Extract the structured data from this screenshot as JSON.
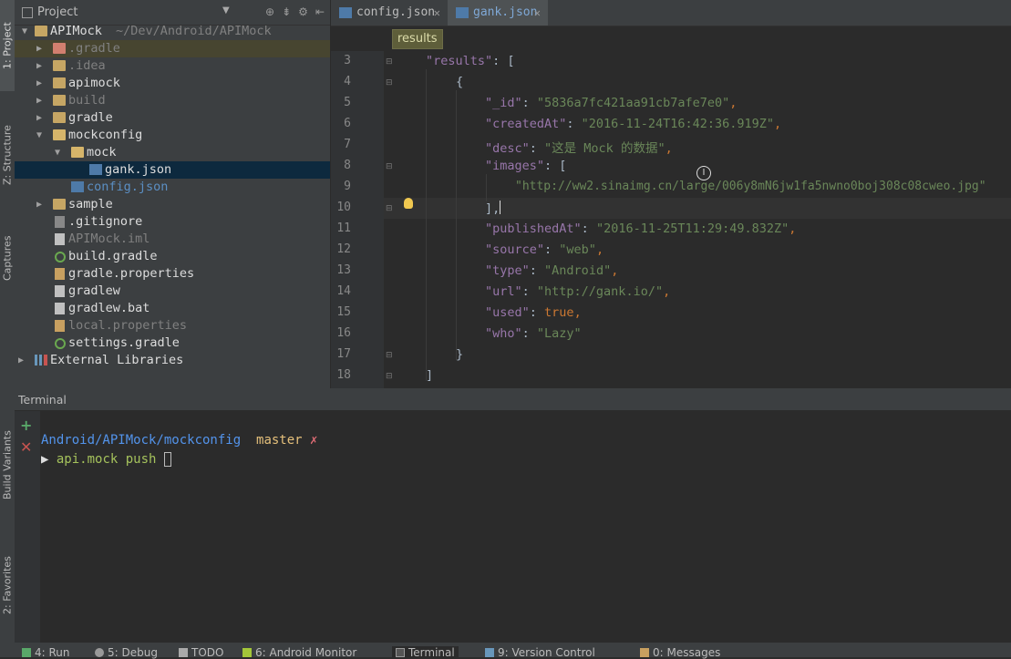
{
  "left_strip": {
    "tabs": [
      {
        "label": "1: Project",
        "active": true
      },
      {
        "label": "Z: Structure",
        "active": false
      },
      {
        "label": "Captures",
        "active": false
      },
      {
        "label": "Build Variants",
        "active": false
      },
      {
        "label": "2: Favorites",
        "active": false
      }
    ]
  },
  "project": {
    "header": "Project",
    "tree": [
      {
        "label": "APIMock",
        "suffix": "~/Dev/Android/APIMock",
        "icon": "folder-icon"
      },
      {
        "label": ".gradle",
        "icon": "folder-icon"
      },
      {
        "label": ".idea",
        "icon": "folder-icon"
      },
      {
        "label": "apimock",
        "icon": "module-folder-icon"
      },
      {
        "label": "build",
        "icon": "folder-icon"
      },
      {
        "label": "gradle",
        "icon": "folder-icon"
      },
      {
        "label": "mockconfig",
        "icon": "module-folder-icon"
      },
      {
        "label": "mock",
        "icon": "folder-icon"
      },
      {
        "label": "gank.json",
        "icon": "json-file-icon"
      },
      {
        "label": "config.json",
        "icon": "json-file-icon"
      },
      {
        "label": "sample",
        "icon": "module-folder-icon"
      },
      {
        "label": ".gitignore",
        "icon": "file-icon"
      },
      {
        "label": "APIMock.iml",
        "icon": "file-icon"
      },
      {
        "label": "build.gradle",
        "icon": "gradle-icon"
      },
      {
        "label": "gradle.properties",
        "icon": "properties-icon"
      },
      {
        "label": "gradlew",
        "icon": "file-icon"
      },
      {
        "label": "gradlew.bat",
        "icon": "file-icon"
      },
      {
        "label": "local.properties",
        "icon": "properties-icon"
      },
      {
        "label": "settings.gradle",
        "icon": "gradle-icon"
      },
      {
        "label": "External Libraries",
        "icon": "library-icon"
      }
    ]
  },
  "editor": {
    "tabs": [
      {
        "label": "config.json",
        "active": false
      },
      {
        "label": "gank.json",
        "active": true
      }
    ],
    "breadcrumb": "results",
    "line_numbers": [
      "3",
      "4",
      "5",
      "6",
      "7",
      "8",
      "9",
      "10",
      "11",
      "12",
      "13",
      "14",
      "15",
      "16",
      "17",
      "18"
    ],
    "code": {
      "l3_key": "\"results\"",
      "l3_rest": ": [",
      "l4": "{",
      "l5_key": "\"_id\"",
      "l5_val": "\"5836a7fc421aa91cb7afe7e0\"",
      "l6_key": "\"createdAt\"",
      "l6_val": "\"2016-11-24T16:42:36.919Z\"",
      "l7_key": "\"desc\"",
      "l7_val": "\"这是 Mock 的数据\"",
      "l8_key": "\"images\"",
      "l8_rest": ": [",
      "l9_val": "\"http://ww2.sinaimg.cn/large/006y8mN6jw1fa5nwno0boj308c08cweo.jpg\"",
      "l10": "],",
      "l11_key": "\"publishedAt\"",
      "l11_val": "\"2016-11-25T11:29:49.832Z\"",
      "l12_key": "\"source\"",
      "l12_val": "\"web\"",
      "l13_key": "\"type\"",
      "l13_val": "\"Android\"",
      "l14_key": "\"url\"",
      "l14_val": "\"http://gank.io/\"",
      "l15_key": "\"used\"",
      "l15_val": "true",
      "l16_key": "\"who\"",
      "l16_val": "\"Lazy\"",
      "l17": "}",
      "l18": "]"
    }
  },
  "terminal": {
    "title": "Terminal",
    "prompt_path": "Android/APIMock/mockconfig",
    "prompt_branch": "master",
    "prompt_dirty": "✗",
    "command": "api.mock push"
  },
  "statusbar": {
    "items": [
      {
        "label": "4: Run"
      },
      {
        "label": "5: Debug"
      },
      {
        "label": "TODO"
      },
      {
        "label": "6: Android Monitor"
      },
      {
        "label": "Terminal",
        "active": true
      },
      {
        "label": "9: Version Control"
      },
      {
        "label": "0: Messages"
      }
    ]
  }
}
